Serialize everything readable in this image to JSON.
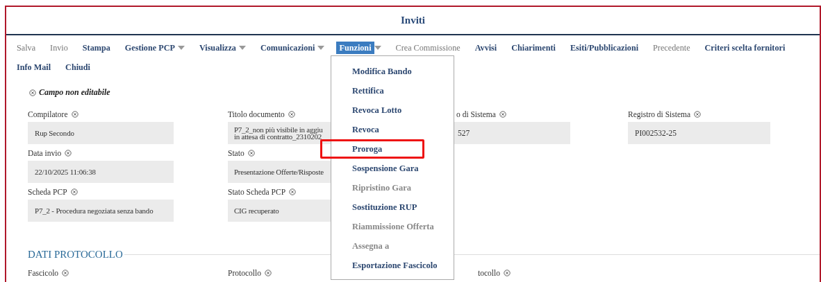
{
  "window": {
    "title": "Inviti"
  },
  "toolbar": [
    {
      "label": "Salva",
      "disabled": true,
      "dropdown": false,
      "selected": false
    },
    {
      "label": "Invio",
      "disabled": true,
      "dropdown": false,
      "selected": false
    },
    {
      "label": "Stampa",
      "disabled": false,
      "dropdown": false,
      "selected": false
    },
    {
      "label": "Gestione PCP",
      "disabled": false,
      "dropdown": true,
      "selected": false
    },
    {
      "label": "Visualizza",
      "disabled": false,
      "dropdown": true,
      "selected": false
    },
    {
      "label": "Comunicazioni",
      "disabled": false,
      "dropdown": true,
      "selected": false
    },
    {
      "label": "Funzioni",
      "disabled": false,
      "dropdown": true,
      "selected": true
    },
    {
      "label": "Crea Commissione",
      "disabled": true,
      "dropdown": false,
      "selected": false
    },
    {
      "label": "Avvisi",
      "disabled": false,
      "dropdown": false,
      "selected": false
    },
    {
      "label": "Chiarimenti",
      "disabled": false,
      "dropdown": false,
      "selected": false
    },
    {
      "label": "Esiti/Pubblicazioni",
      "disabled": false,
      "dropdown": false,
      "selected": false
    },
    {
      "label": "Precedente",
      "disabled": true,
      "dropdown": false,
      "selected": false
    },
    {
      "label": "Criteri scelta fornitori",
      "disabled": false,
      "dropdown": false,
      "selected": false
    },
    {
      "label": "Info Mail",
      "disabled": false,
      "dropdown": false,
      "selected": false
    },
    {
      "label": "Chiudi",
      "disabled": false,
      "dropdown": false,
      "selected": false
    }
  ],
  "menu": [
    {
      "label": "Modifica Bando",
      "disabled": false,
      "highlighted": false
    },
    {
      "label": "Rettifica",
      "disabled": false,
      "highlighted": false
    },
    {
      "label": "Revoca Lotto",
      "disabled": false,
      "highlighted": false
    },
    {
      "label": "Revoca",
      "disabled": false,
      "highlighted": false
    },
    {
      "label": "Proroga",
      "disabled": false,
      "highlighted": true
    },
    {
      "label": "Sospensione Gara",
      "disabled": false,
      "highlighted": false
    },
    {
      "label": "Ripristino Gara",
      "disabled": true,
      "highlighted": false
    },
    {
      "label": "Sostituzione RUP",
      "disabled": false,
      "highlighted": false
    },
    {
      "label": "Riammissione Offerta",
      "disabled": true,
      "highlighted": false
    },
    {
      "label": "Assegna a",
      "disabled": true,
      "highlighted": false
    },
    {
      "label": "Esportazione Fascicolo",
      "disabled": false,
      "highlighted": false
    }
  ],
  "legend": "Campo non editabile",
  "field_rows": [
    [
      {
        "label": "Compilatore",
        "value": "Rup Secondo",
        "editable": false
      },
      {
        "label": "Titolo documento",
        "value": "P7_2_non più visibile in aggiu\nin attesa di contratto_2310202",
        "editable": false
      },
      {
        "label": "o di Sistema",
        "value": "527",
        "editable": false
      },
      {
        "label": "Registro di Sistema",
        "value": "PI002532-25",
        "editable": false
      }
    ],
    [
      {
        "label": "Data invio",
        "value": "22/10/2025 11:06:38",
        "editable": false
      },
      {
        "label": "Stato",
        "value": "Presentazione Offerte/Risposte",
        "editable": false
      },
      null,
      null
    ],
    [
      {
        "label": "Scheda PCP",
        "value": "P7_2 - Procedura negoziata senza bando",
        "editable": false
      },
      {
        "label": "Stato Scheda PCP",
        "value": "CIG recuperato",
        "editable": false
      },
      null,
      null
    ]
  ],
  "section": {
    "title": "DATI PROTOCOLLO",
    "labels": [
      {
        "label": "Fascicolo",
        "editable": false
      },
      {
        "label": "Protocollo",
        "editable": false
      },
      {
        "label": "tocollo",
        "editable": false
      }
    ]
  }
}
